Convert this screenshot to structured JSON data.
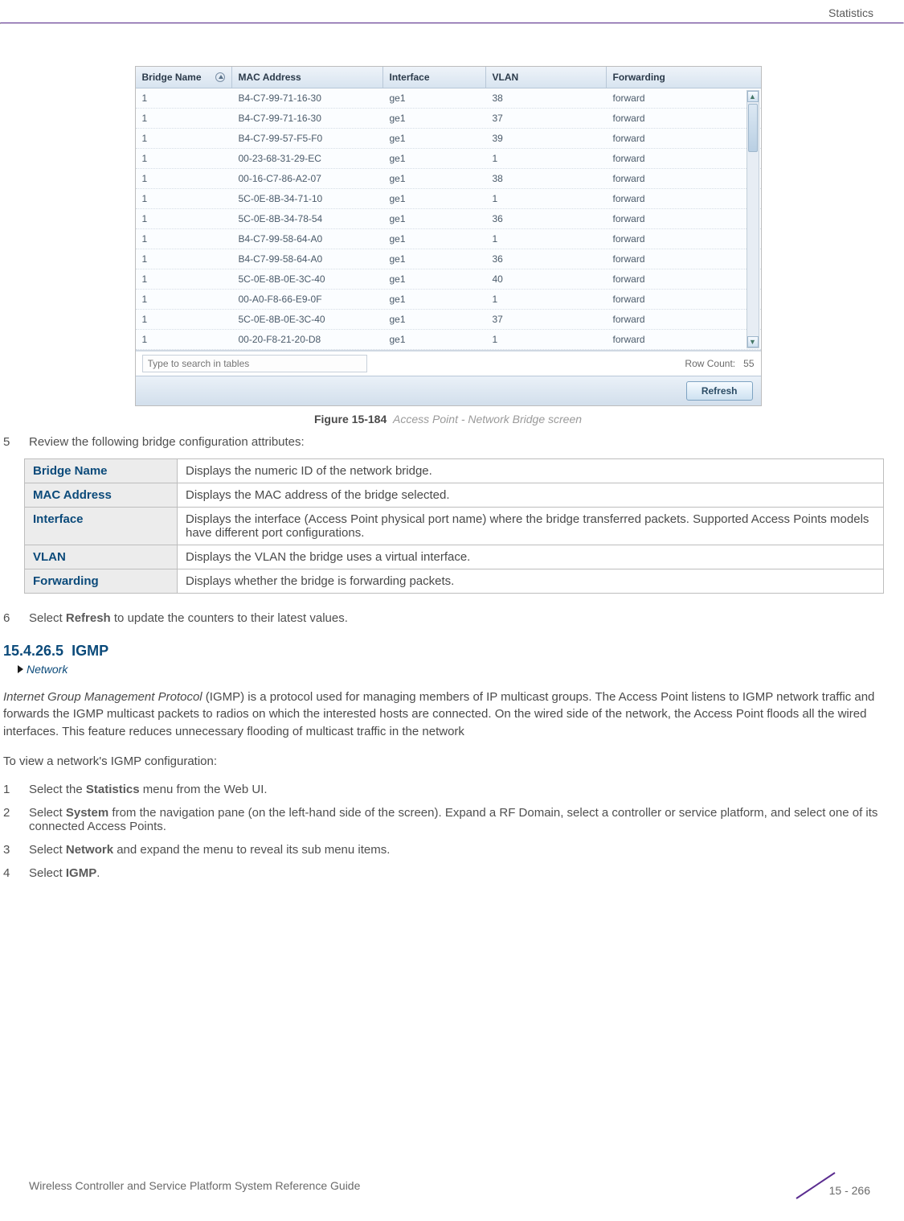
{
  "header": {
    "section": "Statistics"
  },
  "screenshot": {
    "columns": [
      "Bridge Name",
      "MAC Address",
      "Interface",
      "VLAN",
      "Forwarding"
    ],
    "rows": [
      {
        "bn": "1",
        "mac": "B4-C7-99-71-16-30",
        "if": "ge1",
        "vlan": "38",
        "fw": "forward"
      },
      {
        "bn": "1",
        "mac": "B4-C7-99-71-16-30",
        "if": "ge1",
        "vlan": "37",
        "fw": "forward"
      },
      {
        "bn": "1",
        "mac": "B4-C7-99-57-F5-F0",
        "if": "ge1",
        "vlan": "39",
        "fw": "forward"
      },
      {
        "bn": "1",
        "mac": "00-23-68-31-29-EC",
        "if": "ge1",
        "vlan": "1",
        "fw": "forward"
      },
      {
        "bn": "1",
        "mac": "00-16-C7-86-A2-07",
        "if": "ge1",
        "vlan": "38",
        "fw": "forward"
      },
      {
        "bn": "1",
        "mac": "5C-0E-8B-34-71-10",
        "if": "ge1",
        "vlan": "1",
        "fw": "forward"
      },
      {
        "bn": "1",
        "mac": "5C-0E-8B-34-78-54",
        "if": "ge1",
        "vlan": "36",
        "fw": "forward"
      },
      {
        "bn": "1",
        "mac": "B4-C7-99-58-64-A0",
        "if": "ge1",
        "vlan": "1",
        "fw": "forward"
      },
      {
        "bn": "1",
        "mac": "B4-C7-99-58-64-A0",
        "if": "ge1",
        "vlan": "36",
        "fw": "forward"
      },
      {
        "bn": "1",
        "mac": "5C-0E-8B-0E-3C-40",
        "if": "ge1",
        "vlan": "40",
        "fw": "forward"
      },
      {
        "bn": "1",
        "mac": "00-A0-F8-66-E9-0F",
        "if": "ge1",
        "vlan": "1",
        "fw": "forward"
      },
      {
        "bn": "1",
        "mac": "5C-0E-8B-0E-3C-40",
        "if": "ge1",
        "vlan": "37",
        "fw": "forward"
      },
      {
        "bn": "1",
        "mac": "00-20-F8-21-20-D8",
        "if": "ge1",
        "vlan": "1",
        "fw": "forward"
      }
    ],
    "search_placeholder": "Type to search in tables",
    "row_count_label": "Row Count:",
    "row_count_value": "55",
    "refresh_label": "Refresh"
  },
  "figure": {
    "number": "Figure 15-184",
    "title": "Access Point - Network Bridge screen"
  },
  "step5": {
    "num": "5",
    "text": "Review the following bridge configuration attributes:"
  },
  "attr_rows": [
    {
      "k": "Bridge Name",
      "v": "Displays the numeric ID of the network bridge."
    },
    {
      "k": "MAC Address",
      "v": "Displays the MAC address of the bridge selected."
    },
    {
      "k": "Interface",
      "v": "Displays the interface (Access Point physical port name) where the bridge transferred packets. Supported Access Points models have different port configurations."
    },
    {
      "k": "VLAN",
      "v": "Displays the VLAN the bridge uses a virtual interface."
    },
    {
      "k": "Forwarding",
      "v": "Displays whether the bridge is forwarding packets."
    }
  ],
  "step6": {
    "num": "6",
    "pre": "Select ",
    "bold": "Refresh",
    "post": " to update the counters to their latest values."
  },
  "section": {
    "num": "15.4.26.5",
    "title": "IGMP",
    "breadcrumb": "Network"
  },
  "igmp_desc": "Internet Group Management Protocol",
  "igmp_para": " (IGMP) is a protocol used for managing members of IP multicast groups. The Access Point listens to IGMP network traffic and forwards the IGMP multicast packets to radios on which the interested hosts are connected. On the wired side of the network, the Access Point floods all the wired interfaces. This feature reduces unnecessary flooding of multicast traffic in the network",
  "igmp_lead": "To view a network's IGMP configuration:",
  "steps": {
    "s1": {
      "num": "1",
      "pre": "Select the ",
      "bold": "Statistics",
      "post": " menu from the Web UI."
    },
    "s2": {
      "num": "2",
      "pre": "Select ",
      "bold": "System",
      "post": " from the navigation pane (on the left-hand side of the screen). Expand a RF Domain, select a controller or service platform, and select one of its connected Access Points."
    },
    "s3": {
      "num": "3",
      "pre": "Select ",
      "bold": "Network",
      "post": " and expand the menu to reveal its sub menu items."
    },
    "s4": {
      "num": "4",
      "pre": "Select ",
      "bold": "IGMP",
      "post": "."
    }
  },
  "footer": {
    "title": "Wireless Controller and Service Platform System Reference Guide",
    "page": "15 - 266"
  }
}
